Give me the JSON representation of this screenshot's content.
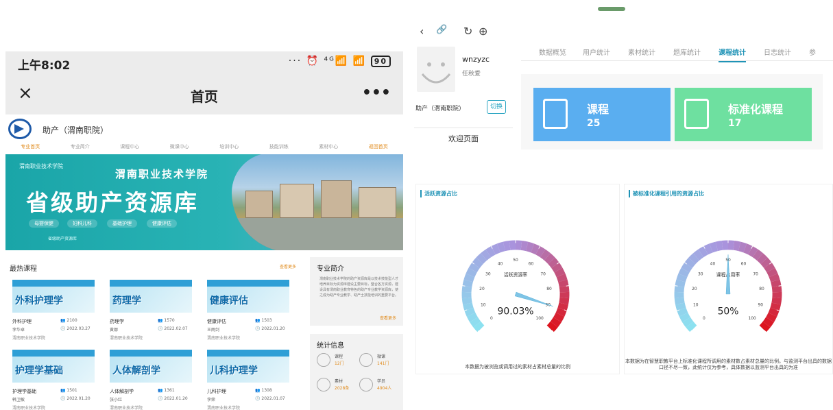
{
  "phone": {
    "status": {
      "time": "上午8:02",
      "icons": "··· ⏰ ⁴ᴳ📶 📶",
      "battery": "90"
    },
    "nav": {
      "close_icon": "×",
      "title": "首页",
      "more": "•••"
    },
    "site": {
      "name": "助产（渭南职院）"
    },
    "topnav": [
      "专业首页",
      "专业简介",
      "课程中心",
      "微课中心",
      "培训中心",
      "技能训练",
      "素材中心",
      "返回首页"
    ],
    "banner": {
      "school": "渭南职业技术学院",
      "college": "渭南职业技术学院",
      "title": "省级助产资源库",
      "tags": [
        "母婴保健",
        "妇科儿科",
        "基础护理",
        "健康评估"
      ],
      "footer": "省级助产资源库"
    },
    "courses": {
      "heading": "最热课程",
      "more": "查看更多",
      "items": [
        {
          "banner": "外科护理学",
          "title": "外科护理",
          "views": "2100",
          "author": "李华卓",
          "date": "2022.03.27",
          "school": "渭南职业技术学院"
        },
        {
          "banner": "药理学",
          "title": "药理学",
          "views": "1570",
          "author": "黄娜",
          "date": "2022.02.07",
          "school": "渭南职业技术学院"
        },
        {
          "banner": "健康评估",
          "title": "健康评估",
          "views": "1503",
          "author": "王雨剑",
          "date": "2022.01.20",
          "school": "渭南职业技术学院"
        },
        {
          "banner": "护理学基础",
          "title": "护理学基础",
          "views": "1501",
          "author": "韩卫敏",
          "date": "2022.01.20",
          "school": "渭南职业技术学院"
        },
        {
          "banner": "人体解剖学",
          "title": "人体解剖学",
          "views": "1361",
          "author": "张小红",
          "date": "2022.01.20",
          "school": "渭南职业技术学院"
        },
        {
          "banner": "儿科护理学",
          "title": "儿科护理",
          "views": "1308",
          "author": "李荣",
          "date": "2022.01.07",
          "school": "渭南职业技术学院"
        }
      ]
    },
    "intro": {
      "heading": "专业简介",
      "text": "渭南职业技术学院的助产资源库是以技术技能型人才培养目标为资源库建设主要目标，整合各方资源，建设具有渭南职业教育特色的助产专业教学资源库，使之成为助产专业教学、助产士技能培训的重要平台。",
      "more": "查看更多"
    },
    "stats": {
      "heading": "统计信息",
      "items": [
        {
          "label": "课程",
          "value": "12门"
        },
        {
          "label": "微课",
          "value": "141门"
        },
        {
          "label": "素材",
          "value": "2028条"
        },
        {
          "label": "学员",
          "value": "4904人"
        }
      ]
    }
  },
  "admin": {
    "browser": {
      "back": "‹",
      "link": "🔗",
      "refresh": "↻",
      "globe": "⊕"
    },
    "user": {
      "name": "wnzyzc",
      "role": "任秋爱",
      "org": "助产（渭南职院）",
      "switch": "切换",
      "welcome": "欢迎页面"
    },
    "tabs": [
      "数据概览",
      "用户统计",
      "素材统计",
      "题库统计",
      "课程统计",
      "日志统计",
      "参"
    ],
    "active_tab": "课程统计",
    "tiles": [
      {
        "label": "课程",
        "value": "25",
        "color": "#5aaef0"
      },
      {
        "label": "标准化课程",
        "value": "17",
        "color": "#6ee0a0"
      }
    ],
    "gauge_left": {
      "title": "活跃资源占比",
      "center_label": "活跃资源率",
      "value_text": "90.03%",
      "value": 90.03,
      "caption": "本数据为被浏览或调用过的素材占素材总量的比例"
    },
    "gauge_right": {
      "title": "被标准化课程引用的资源占比",
      "center_label": "课程占用率",
      "value_text": "50%",
      "value": 50,
      "caption": "本数据为在智慧职教平台上标准化课程所调用的素材数占素材总量的比例。与监测平台出具的数据口径不尽一致，此统计仅为参考，具体数据以监测平台出具的为准"
    },
    "gauge_ticks": [
      "0",
      "10",
      "20",
      "30",
      "40",
      "50",
      "60",
      "70",
      "80",
      "90",
      "100"
    ]
  }
}
